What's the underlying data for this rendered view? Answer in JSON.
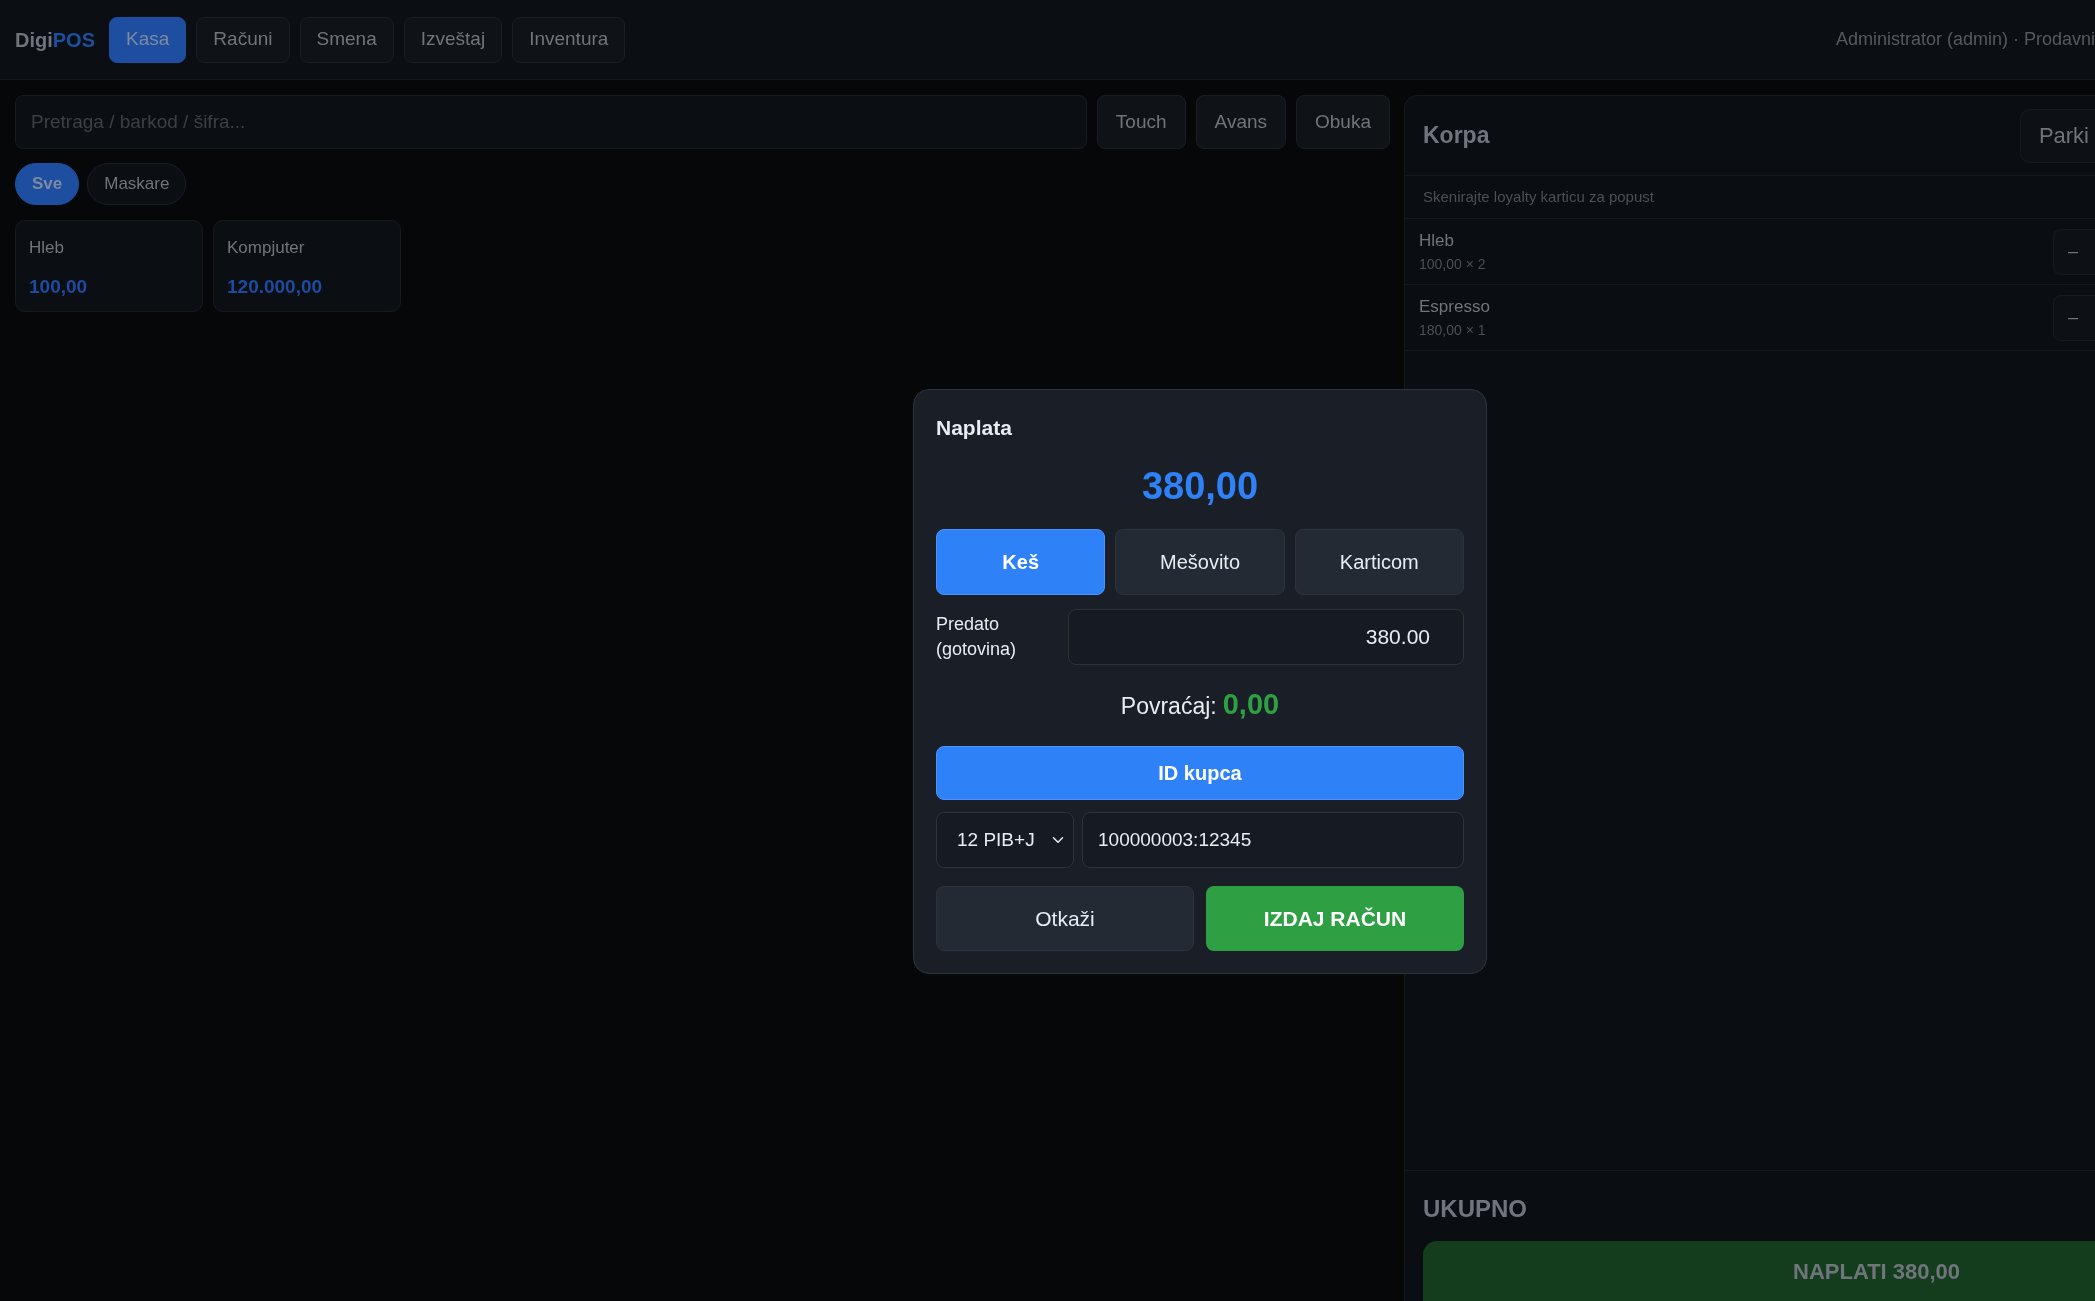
{
  "header": {
    "logo": {
      "part_1": "Digi",
      "part_2": "POS"
    },
    "tabs": [
      {
        "label": "Kasa",
        "selected": true
      },
      {
        "label": "Računi",
        "selected": false
      },
      {
        "label": "Smena",
        "selected": false
      },
      {
        "label": "Izveštaj",
        "selected": false
      },
      {
        "label": "Inventura",
        "selected": false
      }
    ],
    "user": "Administrator (admin) · Prodavni"
  },
  "search": {
    "placeholder": "Pretraga / barkod / šifra..."
  },
  "toolbar_buttons": [
    "Touch",
    "Avans",
    "Obuka"
  ],
  "categories": [
    {
      "label": "Sve",
      "selected": true
    },
    {
      "label": "Maskare",
      "selected": false
    }
  ],
  "products": [
    {
      "name": "Hleb",
      "price": "100,00"
    },
    {
      "name": "Kompjuter",
      "price": "120.000,00"
    }
  ],
  "cart": {
    "title": "Korpa",
    "park_button": "Parki",
    "loyalty_hint": "Skenirajte loyalty karticu za popust",
    "items": [
      {
        "name": "Hleb",
        "detail": "100,00 × 2",
        "button": "–"
      },
      {
        "name": "Espresso",
        "detail": "180,00 × 1",
        "button": "–"
      }
    ],
    "total_label": "UKUPNO",
    "pay_button": "NAPLATI 380,00"
  },
  "payment_dialog": {
    "title": "Naplata",
    "amount": "380,00",
    "methods": [
      {
        "label": "Keš",
        "selected": true
      },
      {
        "label": "Mešovito",
        "selected": false
      },
      {
        "label": "Karticom",
        "selected": false
      }
    ],
    "tendered_label": "Predato (gotovina)",
    "tendered_value": "380.00",
    "change_label": "Povraćaj:",
    "change_value": "0,00",
    "customer_id_button": "ID kupca",
    "id_type": "12 PIB+J",
    "id_value": "100000003:12345",
    "cancel_button": "Otkaži",
    "issue_button": "IZDAJ RAČUN"
  }
}
